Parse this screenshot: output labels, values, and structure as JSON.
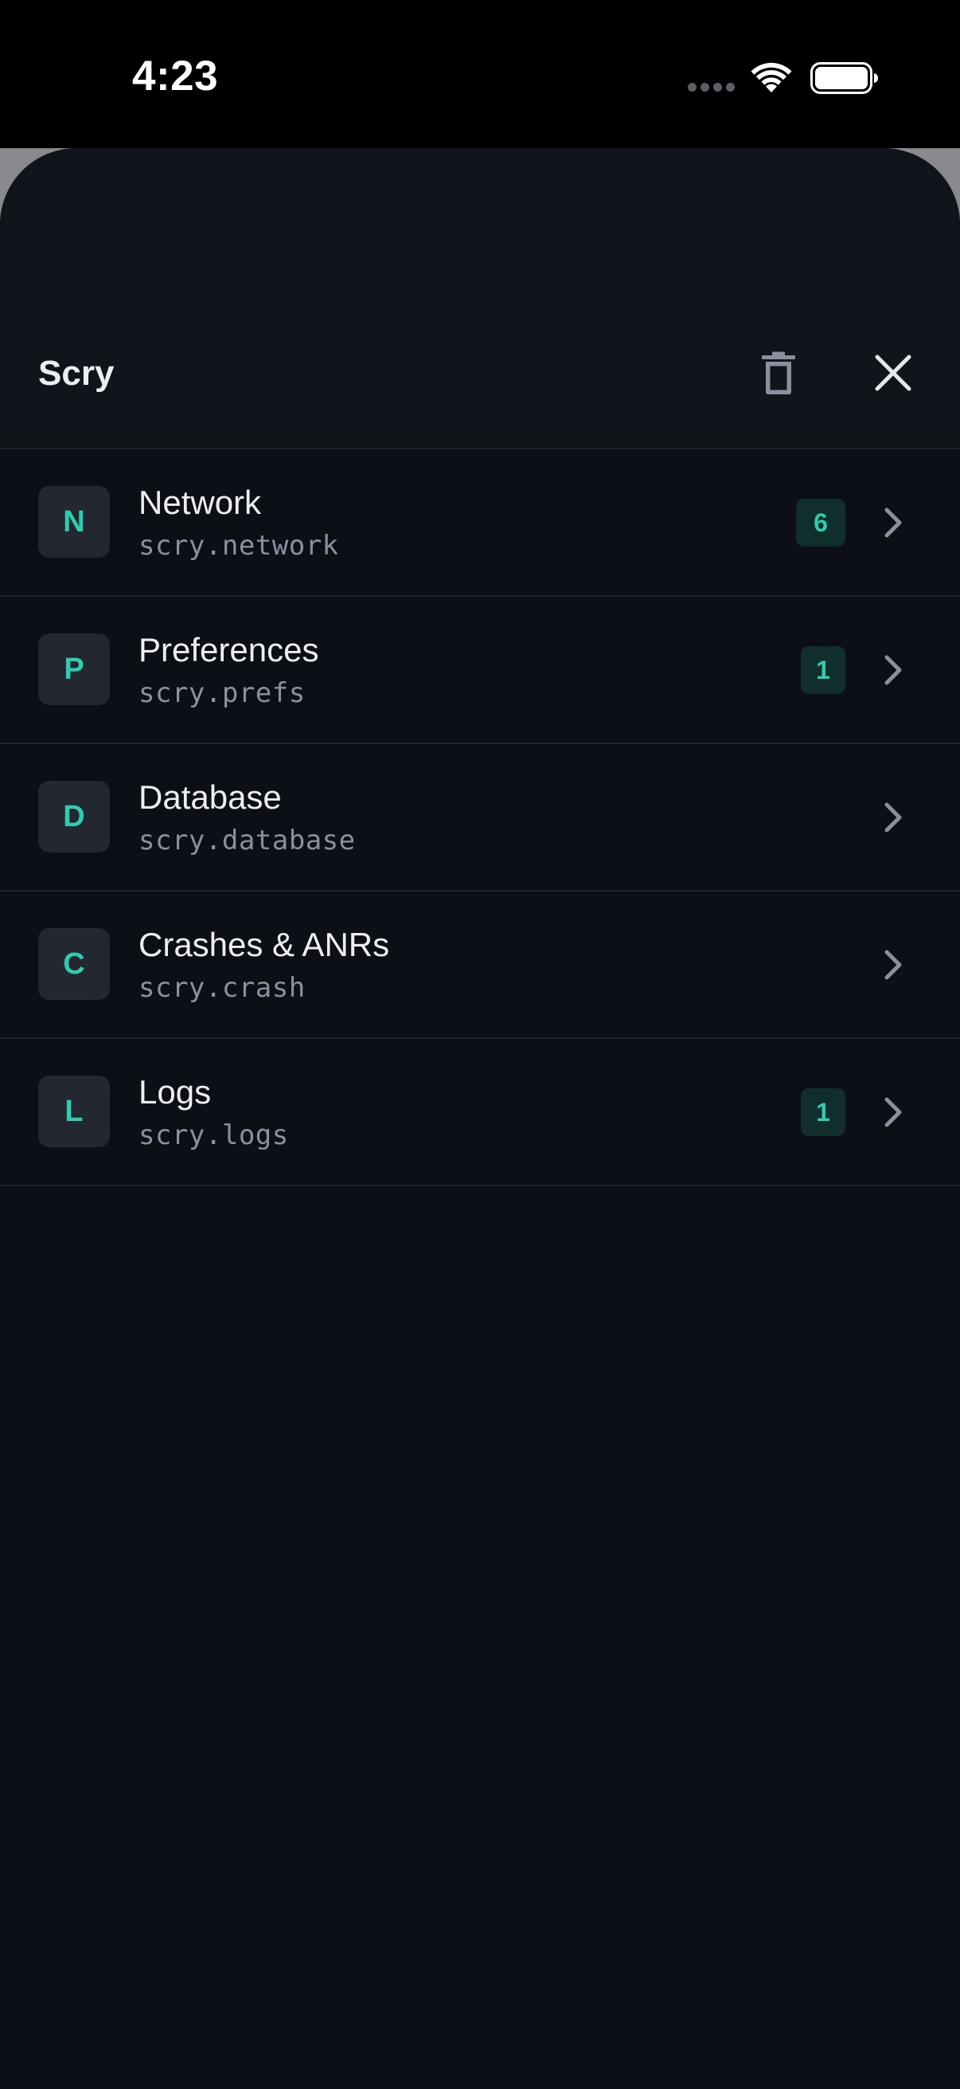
{
  "status_bar": {
    "time": "4:23"
  },
  "sheet": {
    "title": "Scry",
    "actions": {
      "clear_icon": "trash-icon",
      "close_icon": "close-icon"
    }
  },
  "plugins": [
    {
      "initial": "N",
      "title": "Network",
      "id": "scry.network",
      "count": "6"
    },
    {
      "initial": "P",
      "title": "Preferences",
      "id": "scry.prefs",
      "count": "1"
    },
    {
      "initial": "D",
      "title": "Database",
      "id": "scry.database",
      "count": null
    },
    {
      "initial": "C",
      "title": "Crashes & ANRs",
      "id": "scry.crash",
      "count": null
    },
    {
      "initial": "L",
      "title": "Logs",
      "id": "scry.logs",
      "count": "1"
    }
  ],
  "colors": {
    "accent": "#2FCCB0",
    "sheet_background": "#0C0F16",
    "header_background": "#10151C",
    "badge_background": "#0F2E2C",
    "avatar_background": "#232830",
    "divider": "#1E242C",
    "secondary_text": "#8A919C"
  }
}
